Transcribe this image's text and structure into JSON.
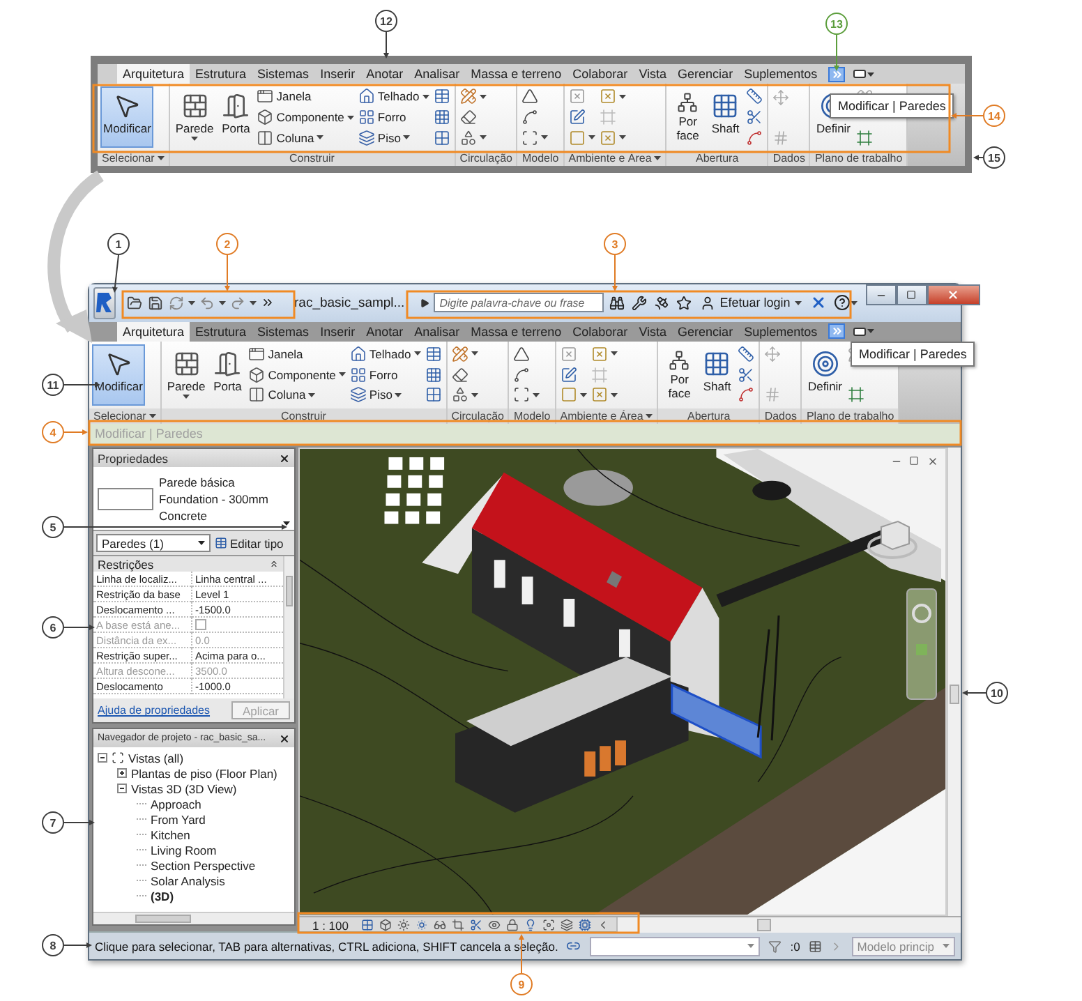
{
  "ribbon_detail": {
    "tabs": [
      {
        "label": "Arquitetura",
        "selected": true
      },
      {
        "label": "Estrutura",
        "selected": false
      },
      {
        "label": "Sistemas",
        "selected": false
      },
      {
        "label": "Inserir",
        "selected": false
      },
      {
        "label": "Anotar",
        "selected": false
      },
      {
        "label": "Analisar",
        "selected": false
      },
      {
        "label": "Massa e terreno",
        "selected": false
      },
      {
        "label": "Colaborar",
        "selected": false
      },
      {
        "label": "Vista",
        "selected": false
      },
      {
        "label": "Gerenciar",
        "selected": false
      },
      {
        "label": "Suplementos",
        "selected": false
      }
    ],
    "panels": [
      {
        "title": "Selecionar",
        "menu": true,
        "groups": [
          {
            "kind": "large",
            "label": "Modificar",
            "menu": false,
            "selected": true
          }
        ]
      },
      {
        "title": "Construir",
        "menu": false,
        "groups": [
          {
            "kind": "large",
            "label": "Parede",
            "menu": true,
            "selected": false
          },
          {
            "kind": "large",
            "label": "Porta",
            "menu": false,
            "selected": false
          },
          {
            "kind": "stack",
            "items": [
              {
                "kind": "small",
                "label": "Janela",
                "menu": false
              },
              {
                "kind": "small",
                "label": "Componente",
                "menu": true
              },
              {
                "kind": "small",
                "label": "Coluna",
                "menu": true
              }
            ]
          },
          {
            "kind": "stack",
            "items": [
              {
                "kind": "small",
                "label": "Telhado",
                "menu": true
              },
              {
                "kind": "small",
                "label": "Forro",
                "menu": false
              },
              {
                "kind": "small",
                "label": "Piso",
                "menu": true
              }
            ]
          },
          {
            "kind": "stack",
            "items": [
              {
                "kind": "icon",
                "menu": false
              },
              {
                "kind": "icon",
                "menu": false
              },
              {
                "kind": "icon",
                "menu": false
              }
            ]
          }
        ]
      },
      {
        "title": "Circulação",
        "menu": false,
        "groups": [
          {
            "kind": "stack",
            "items": [
              {
                "kind": "icon",
                "menu": true
              },
              {
                "kind": "icon",
                "menu": false
              },
              {
                "kind": "icon",
                "menu": true
              }
            ]
          }
        ]
      },
      {
        "title": "Modelo",
        "menu": false,
        "groups": [
          {
            "kind": "stack",
            "items": [
              {
                "kind": "icon",
                "menu": false
              },
              {
                "kind": "icon",
                "menu": false
              },
              {
                "kind": "icon",
                "menu": true
              }
            ]
          }
        ]
      },
      {
        "title": "Ambiente e Área",
        "menu": true,
        "groups": [
          {
            "kind": "stack",
            "items": [
              {
                "kind": "icon",
                "menu": false
              },
              {
                "kind": "icon",
                "menu": false
              },
              {
                "kind": "icon",
                "menu": true
              }
            ]
          },
          {
            "kind": "stack",
            "items": [
              {
                "kind": "icon",
                "menu": true
              },
              {
                "kind": "icon",
                "menu": false
              },
              {
                "kind": "icon",
                "menu": true
              }
            ]
          }
        ]
      },
      {
        "title": "Abertura",
        "menu": false,
        "groups": [
          {
            "kind": "large",
            "label": "Por face",
            "menu": false,
            "selected": false
          },
          {
            "kind": "large",
            "label": "Shaft",
            "menu": false,
            "selected": false
          },
          {
            "kind": "stack",
            "items": [
              {
                "kind": "icon",
                "menu": false
              },
              {
                "kind": "icon",
                "menu": false
              },
              {
                "kind": "icon",
                "menu": false
              }
            ]
          }
        ]
      },
      {
        "title": "Dados",
        "menu": false,
        "groups": [
          {
            "kind": "stack",
            "items": [
              {
                "kind": "icon",
                "menu": false
              },
              {
                "kind": "icon",
                "menu": false
              }
            ]
          }
        ]
      },
      {
        "title": "Plano de trabalho",
        "menu": false,
        "groups": [
          {
            "kind": "large",
            "label": "Definir",
            "menu": false,
            "selected": false
          },
          {
            "kind": "stack",
            "items": [
              {
                "kind": "icon",
                "menu": false
              },
              {
                "kind": "icon",
                "menu": false
              }
            ]
          }
        ]
      }
    ],
    "tooltip": "Modificar | Paredes"
  },
  "window": {
    "document_title": "rac_basic_sampl...",
    "search": {
      "placeholder": "Digite palavra-chave ou frase"
    },
    "login": "Efetuar login",
    "ribbon": {
      "tabs": [
        {
          "label": "Arquitetura",
          "selected": true
        },
        {
          "label": "Estrutura",
          "selected": false
        },
        {
          "label": "Sistemas",
          "selected": false
        },
        {
          "label": "Inserir",
          "selected": false
        },
        {
          "label": "Anotar",
          "selected": false
        },
        {
          "label": "Analisar",
          "selected": false
        },
        {
          "label": "Massa e terreno",
          "selected": false
        },
        {
          "label": "Colaborar",
          "selected": false
        },
        {
          "label": "Vista",
          "selected": false
        },
        {
          "label": "Gerenciar",
          "selected": false
        },
        {
          "label": "Suplementos",
          "selected": false
        }
      ],
      "panels": [
        {
          "title": "Selecionar",
          "menu": true,
          "groups": [
            {
              "kind": "large",
              "label": "Modificar",
              "menu": false,
              "selected": true
            }
          ]
        },
        {
          "title": "Construir",
          "menu": false,
          "groups": [
            {
              "kind": "large",
              "label": "Parede",
              "menu": true,
              "selected": false
            },
            {
              "kind": "large",
              "label": "Porta",
              "menu": false,
              "selected": false
            },
            {
              "kind": "stack",
              "items": [
                {
                  "kind": "small",
                  "label": "Janela",
                  "menu": false
                },
                {
                  "kind": "small",
                  "label": "Componente",
                  "menu": true
                },
                {
                  "kind": "small",
                  "label": "Coluna",
                  "menu": true
                }
              ]
            },
            {
              "kind": "stack",
              "items": [
                {
                  "kind": "small",
                  "label": "Telhado",
                  "menu": true
                },
                {
                  "kind": "small",
                  "label": "Forro",
                  "menu": false
                },
                {
                  "kind": "small",
                  "label": "Piso",
                  "menu": true
                }
              ]
            },
            {
              "kind": "stack",
              "items": [
                {
                  "kind": "icon",
                  "menu": false
                },
                {
                  "kind": "icon",
                  "menu": false
                },
                {
                  "kind": "icon",
                  "menu": false
                }
              ]
            }
          ]
        },
        {
          "title": "Circulação",
          "menu": false,
          "groups": [
            {
              "kind": "stack",
              "items": [
                {
                  "kind": "icon",
                  "menu": true
                },
                {
                  "kind": "icon",
                  "menu": false
                },
                {
                  "kind": "icon",
                  "menu": true
                }
              ]
            }
          ]
        },
        {
          "title": "Modelo",
          "menu": false,
          "groups": [
            {
              "kind": "stack",
              "items": [
                {
                  "kind": "icon",
                  "menu": false
                },
                {
                  "kind": "icon",
                  "menu": false
                },
                {
                  "kind": "icon",
                  "menu": true
                }
              ]
            }
          ]
        },
        {
          "title": "Ambiente e Área",
          "menu": true,
          "groups": [
            {
              "kind": "stack",
              "items": [
                {
                  "kind": "icon",
                  "menu": false
                },
                {
                  "kind": "icon",
                  "menu": false
                },
                {
                  "kind": "icon",
                  "menu": true
                }
              ]
            },
            {
              "kind": "stack",
              "items": [
                {
                  "kind": "icon",
                  "menu": true
                },
                {
                  "kind": "icon",
                  "menu": false
                },
                {
                  "kind": "icon",
                  "menu": true
                }
              ]
            }
          ]
        },
        {
          "title": "Abertura",
          "menu": false,
          "groups": [
            {
              "kind": "large",
              "label": "Por face",
              "menu": false,
              "selected": false
            },
            {
              "kind": "large",
              "label": "Shaft",
              "menu": false,
              "selected": false
            },
            {
              "kind": "stack",
              "items": [
                {
                  "kind": "icon",
                  "menu": false
                },
                {
                  "kind": "icon",
                  "menu": false
                },
                {
                  "kind": "icon",
                  "menu": false
                }
              ]
            }
          ]
        },
        {
          "title": "Dados",
          "menu": false,
          "groups": [
            {
              "kind": "stack",
              "items": [
                {
                  "kind": "icon",
                  "menu": false
                },
                {
                  "kind": "icon",
                  "menu": false
                }
              ]
            }
          ]
        },
        {
          "title": "Plano de trabalho",
          "menu": false,
          "groups": [
            {
              "kind": "large",
              "label": "Definir",
              "menu": false,
              "selected": false
            },
            {
              "kind": "stack",
              "items": [
                {
                  "kind": "icon",
                  "menu": false
                },
                {
                  "kind": "icon",
                  "menu": false
                }
              ]
            }
          ]
        }
      ],
      "tooltip": "Modificar | Paredes"
    },
    "options_bar": "Modificar | Paredes",
    "properties": {
      "title": "Propriedades",
      "type_lines": [
        "Parede básica",
        "Foundation - 300mm",
        "Concrete"
      ],
      "instance_filter": "Paredes (1)",
      "edit_type": "Editar tipo",
      "group": "Restrições",
      "rows": [
        {
          "name": "Linha de localiz...",
          "kind": "text",
          "value": "Linha central ...",
          "disabled": false
        },
        {
          "name": "Restrição da base",
          "kind": "text",
          "value": "Level 1",
          "disabled": false
        },
        {
          "name": "Deslocamento ...",
          "kind": "text",
          "value": "-1500.0",
          "disabled": false
        },
        {
          "name": "A base está ane...",
          "kind": "checkbox",
          "checked": false,
          "disabled": true
        },
        {
          "name": "Distância da ex...",
          "kind": "text",
          "value": "0.0",
          "disabled": true
        },
        {
          "name": "Restrição super...",
          "kind": "text",
          "value": "Acima para o...",
          "disabled": false
        },
        {
          "name": "Altura descone...",
          "kind": "text",
          "value": "3500.0",
          "disabled": true
        },
        {
          "name": "Deslocamento",
          "kind": "text",
          "value": "-1000.0",
          "disabled": false
        }
      ],
      "help_link": "Ajuda de propriedades",
      "apply": {
        "label": "Aplicar",
        "disabled": true
      }
    },
    "project_browser": {
      "title": "Navegador de projeto - rac_basic_sa...",
      "tree": [
        {
          "label": "Vistas (all)",
          "expanded": true,
          "current": false,
          "children": [
            {
              "label": "Plantas de piso (Floor Plan)",
              "expanded": false,
              "current": false
            },
            {
              "label": "Vistas 3D (3D View)",
              "expanded": true,
              "current": false,
              "children": [
                {
                  "label": "Approach",
                  "current": false
                },
                {
                  "label": "From Yard",
                  "current": false
                },
                {
                  "label": "Kitchen",
                  "current": false
                },
                {
                  "label": "Living Room",
                  "current": false
                },
                {
                  "label": "Section Perspective",
                  "current": false
                },
                {
                  "label": "Solar Analysis",
                  "current": false
                },
                {
                  "label": "(3D)",
                  "current": true
                }
              ]
            }
          ]
        }
      ]
    },
    "view_control_bar": {
      "scale": "1 : 100"
    },
    "status_bar": {
      "message": "Clique para selecionar, TAB para alternativas, CTRL adiciona, SHIFT cancela a seleção.",
      "count": ":0",
      "model": "Modelo princip"
    }
  },
  "callouts": [
    {
      "number": "1",
      "color": "#3c3c3c"
    },
    {
      "number": "2",
      "color": "#e07b24"
    },
    {
      "number": "3",
      "color": "#e07b24"
    },
    {
      "number": "4",
      "color": "#e07b24"
    },
    {
      "number": "5",
      "color": "#3c3c3c"
    },
    {
      "number": "6",
      "color": "#3c3c3c"
    },
    {
      "number": "7",
      "color": "#3c3c3c"
    },
    {
      "number": "8",
      "color": "#3c3c3c"
    },
    {
      "number": "9",
      "color": "#e07b24"
    },
    {
      "number": "10",
      "color": "#3c3c3c"
    },
    {
      "number": "11",
      "color": "#3c3c3c"
    },
    {
      "number": "12",
      "color": "#3c3c3c"
    },
    {
      "number": "13",
      "color": "#5c9e3c"
    },
    {
      "number": "14",
      "color": "#e07b24"
    },
    {
      "number": "15",
      "color": "#3c3c3c"
    }
  ]
}
